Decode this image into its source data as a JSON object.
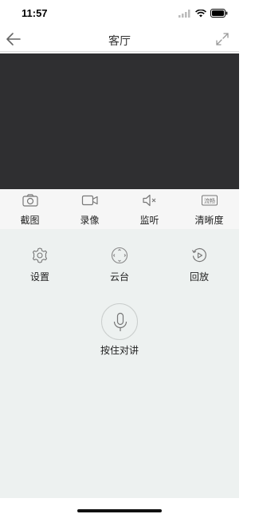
{
  "status_bar": {
    "time": "11:57"
  },
  "nav": {
    "title": "客厅"
  },
  "toolbar": {
    "items": [
      {
        "label": "截图",
        "icon": "camera-icon"
      },
      {
        "label": "录像",
        "icon": "video-camera-icon"
      },
      {
        "label": "监听",
        "icon": "speaker-muted-icon"
      },
      {
        "label": "清晰度",
        "icon": "quality-icon",
        "badge": "流畅"
      }
    ]
  },
  "controls": {
    "items": [
      {
        "label": "设置",
        "icon": "gear-icon"
      },
      {
        "label": "云台",
        "icon": "ptz-icon"
      },
      {
        "label": "回放",
        "icon": "playback-icon"
      }
    ],
    "talk": {
      "label": "按住对讲",
      "icon": "microphone-icon"
    }
  },
  "colors": {
    "video_bg": "#2f2f31",
    "toolbar_bg": "#f6f6f6",
    "controls_bg": "#edf1f0"
  }
}
